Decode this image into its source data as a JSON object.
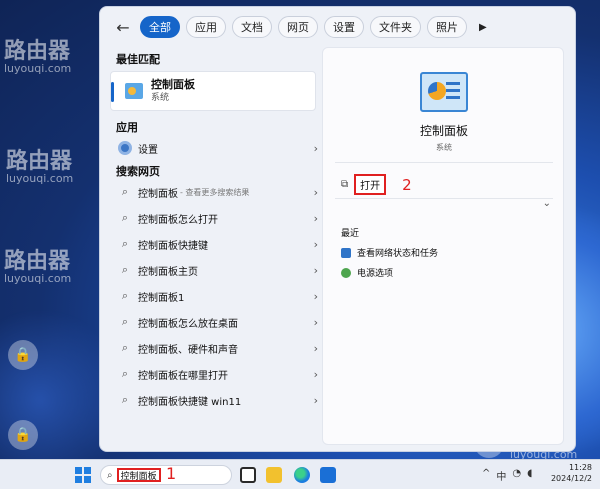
{
  "search_tabs": {
    "back": "←",
    "items": [
      "全部",
      "应用",
      "文档",
      "网页",
      "设置",
      "文件夹",
      "照片"
    ],
    "more": "▶"
  },
  "left_panel": {
    "best_match_title": "最佳匹配",
    "best_match": {
      "name": "控制面板",
      "subtitle": "系统"
    },
    "apps_title": "应用",
    "apps": [
      {
        "label": "设置"
      }
    ],
    "web_title": "搜索网页",
    "web_results": [
      {
        "label": "控制面板",
        "hint": "- 查看更多搜索结果"
      },
      {
        "label": "控制面板怎么打开",
        "hint": ""
      },
      {
        "label": "控制面板快捷键",
        "hint": ""
      },
      {
        "label": "控制面板主页",
        "hint": ""
      },
      {
        "label": "控制面板1",
        "hint": ""
      },
      {
        "label": "控制面板怎么放在桌面",
        "hint": ""
      },
      {
        "label": "控制面板、硬件和声音",
        "hint": ""
      },
      {
        "label": "控制面板在哪里打开",
        "hint": ""
      },
      {
        "label": "控制面板快捷键 win11",
        "hint": ""
      }
    ]
  },
  "right_panel": {
    "title": "控制面板",
    "subtitle": "系统",
    "open_label": "打开",
    "step_marker": "2",
    "recent_title": "最近",
    "recent": [
      {
        "label": "查看网络状态和任务",
        "icon": "network-icon"
      },
      {
        "label": "电源选项",
        "icon": "power-icon"
      }
    ]
  },
  "taskbar": {
    "search_text": "控制面板",
    "step_marker": "1",
    "time": "11:28",
    "date": "2024/12/2",
    "tray_chevron": "^"
  },
  "watermark": {
    "text": "路由器",
    "url": "luyouqi.com"
  },
  "colors": {
    "accent": "#1565c9",
    "highlight": "#e02020"
  }
}
